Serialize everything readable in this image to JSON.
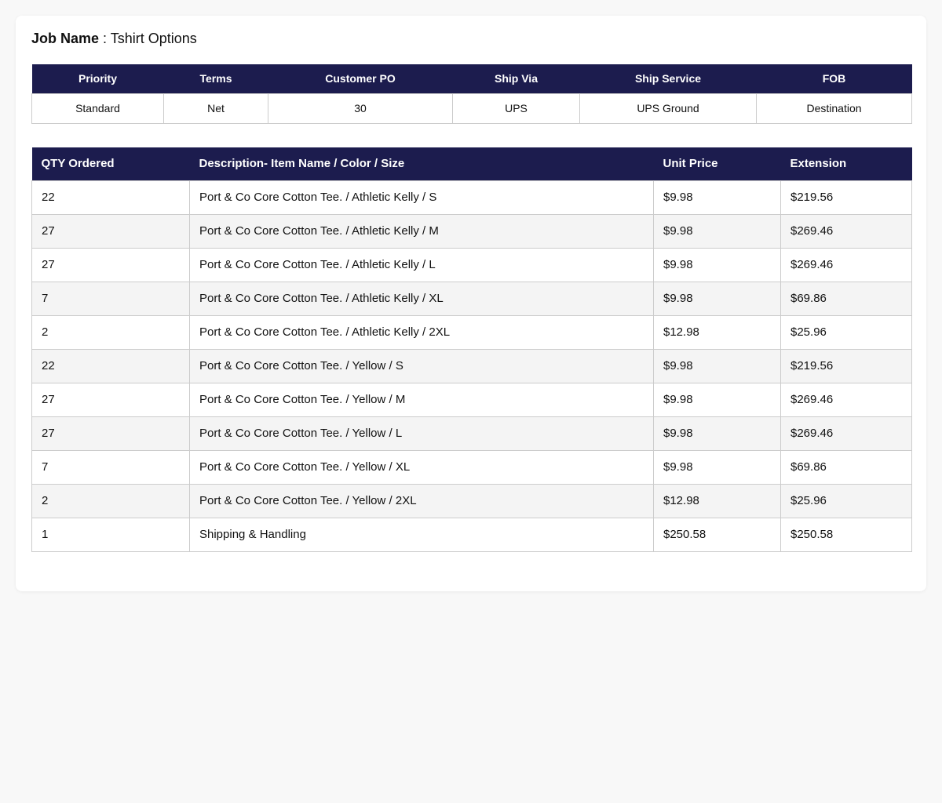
{
  "job": {
    "label": "Job Name",
    "separator": " : ",
    "value": "Tshirt Options"
  },
  "summary": {
    "headers": [
      "Priority",
      "Terms",
      "Customer PO",
      "Ship Via",
      "Ship Service",
      "FOB"
    ],
    "values": [
      "Standard",
      "Net",
      "30",
      "UPS",
      "UPS Ground",
      "Destination"
    ]
  },
  "items": {
    "headers": [
      "QTY Ordered",
      "Description- Item Name / Color / Size",
      "Unit Price",
      "Extension"
    ],
    "rows": [
      {
        "qty": "22",
        "desc": "Port & Co Core Cotton Tee. / Athletic Kelly / S",
        "price": "$9.98",
        "ext": "$219.56"
      },
      {
        "qty": "27",
        "desc": "Port & Co Core Cotton Tee. / Athletic Kelly / M",
        "price": "$9.98",
        "ext": "$269.46"
      },
      {
        "qty": "27",
        "desc": "Port & Co Core Cotton Tee. / Athletic Kelly / L",
        "price": "$9.98",
        "ext": "$269.46"
      },
      {
        "qty": "7",
        "desc": "Port & Co Core Cotton Tee. / Athletic Kelly / XL",
        "price": "$9.98",
        "ext": "$69.86"
      },
      {
        "qty": "2",
        "desc": "Port & Co Core Cotton Tee. / Athletic Kelly / 2XL",
        "price": "$12.98",
        "ext": "$25.96"
      },
      {
        "qty": "22",
        "desc": "Port & Co Core Cotton Tee. / Yellow / S",
        "price": "$9.98",
        "ext": "$219.56"
      },
      {
        "qty": "27",
        "desc": "Port & Co Core Cotton Tee. / Yellow / M",
        "price": "$9.98",
        "ext": "$269.46"
      },
      {
        "qty": "27",
        "desc": "Port & Co Core Cotton Tee. / Yellow / L",
        "price": "$9.98",
        "ext": "$269.46"
      },
      {
        "qty": "7",
        "desc": "Port & Co Core Cotton Tee. / Yellow / XL",
        "price": "$9.98",
        "ext": "$69.86"
      },
      {
        "qty": "2",
        "desc": "Port & Co Core Cotton Tee. / Yellow / 2XL",
        "price": "$12.98",
        "ext": "$25.96"
      },
      {
        "qty": "1",
        "desc": "Shipping & Handling",
        "price": "$250.58",
        "ext": "$250.58"
      }
    ]
  },
  "colors": {
    "header_bg": "#1c1c4e",
    "header_text": "#ffffff",
    "page_bg": "#f8f8f8",
    "stripe_bg": "#f4f4f4"
  }
}
